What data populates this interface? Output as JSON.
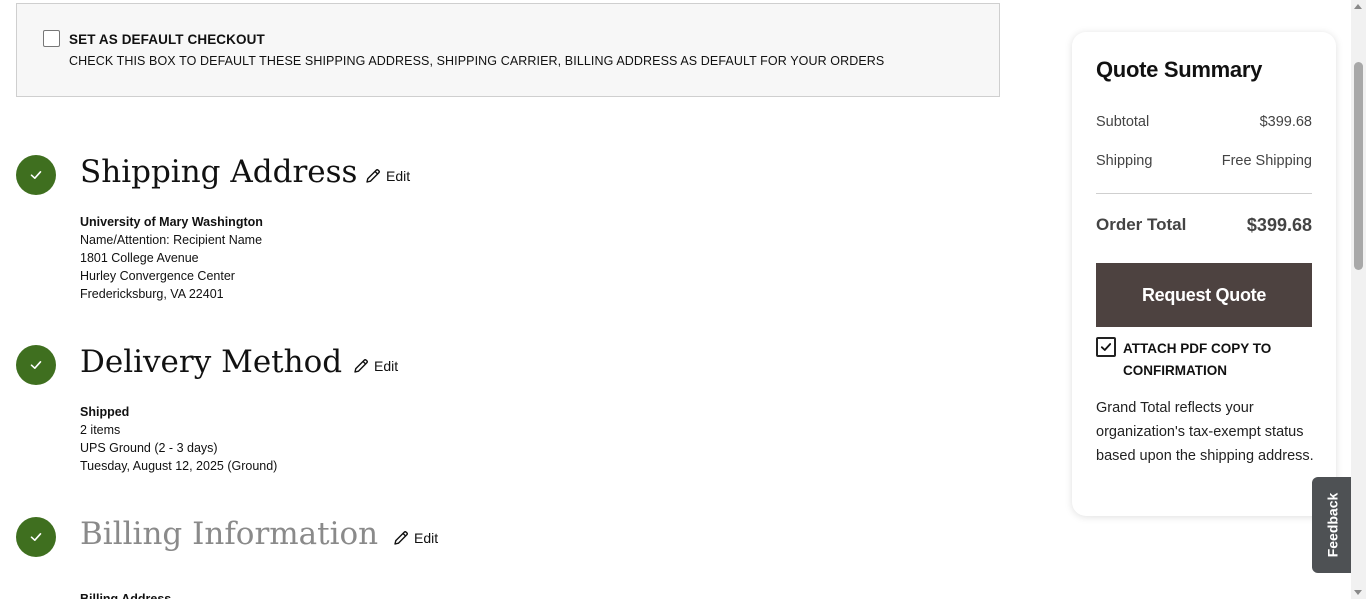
{
  "default_checkout": {
    "checked": false,
    "title": "SET AS DEFAULT CHECKOUT",
    "description": "CHECK THIS BOX TO DEFAULT THESE SHIPPING ADDRESS, SHIPPING CARRIER, BILLING ADDRESS AS DEFAULT FOR YOUR ORDERS"
  },
  "shipping_address": {
    "title": "Shipping Address",
    "edit_label": "Edit",
    "lines": {
      "organization": "University of Mary Washington",
      "attention": "Name/Attention: Recipient Name",
      "street": "1801 College Avenue",
      "building": "Hurley Convergence Center",
      "city_state_zip": "Fredericksburg, VA 22401"
    }
  },
  "delivery_method": {
    "title": "Delivery Method",
    "edit_label": "Edit",
    "lines": {
      "method": "Shipped",
      "items": "2 items",
      "carrier": "UPS Ground (2 - 3 days)",
      "date": "Tuesday, August 12, 2025 (Ground)"
    }
  },
  "billing_information": {
    "title": "Billing Information",
    "edit_label": "Edit",
    "partial_label": "Billing Address"
  },
  "summary": {
    "title": "Quote Summary",
    "subtotal_label": "Subtotal",
    "subtotal_value": "$399.68",
    "shipping_label": "Shipping",
    "shipping_value": "Free Shipping",
    "total_label": "Order Total",
    "total_value": "$399.68",
    "request_button": "Request Quote",
    "attach_checked": true,
    "attach_label": "ATTACH PDF COPY TO CONFIRMATION",
    "grand_total_note": "Grand Total reflects your organization's tax-exempt status based upon the shipping address."
  },
  "feedback_tab": "Feedback",
  "colors": {
    "step_complete": "#3f6f1f",
    "request_button": "#4d4240",
    "feedback_tab": "#4e5154"
  }
}
